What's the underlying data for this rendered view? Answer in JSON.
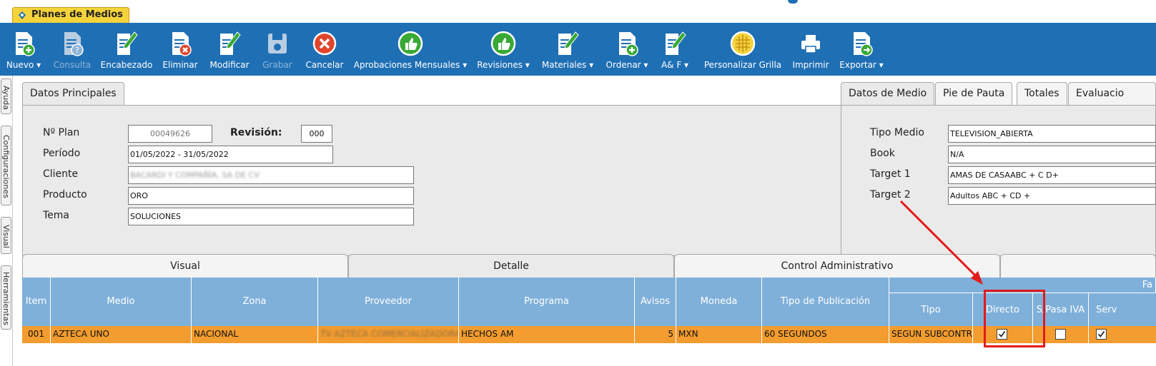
{
  "window": {
    "tab_title": "Planes de Medios"
  },
  "toolbar": {
    "items": [
      {
        "label": "Nuevo ▾",
        "icon": "document-add-icon",
        "enabled": true
      },
      {
        "label": "Consulta",
        "icon": "document-query-icon",
        "enabled": false
      },
      {
        "label": "Encabezado",
        "icon": "document-edit-icon",
        "enabled": true
      },
      {
        "label": "Eliminar",
        "icon": "document-delete-icon",
        "enabled": true
      },
      {
        "label": "Modificar",
        "icon": "document-edit-icon",
        "enabled": true
      },
      {
        "label": "Grabar",
        "icon": "save-icon",
        "enabled": false
      },
      {
        "label": "Cancelar",
        "icon": "cancel-icon",
        "enabled": true
      },
      {
        "label": "Aprobaciones Mensuales ▾",
        "icon": "thumbs-up-icon",
        "enabled": true
      },
      {
        "label": "Revisiones ▾",
        "icon": "thumbs-up-icon",
        "enabled": true
      },
      {
        "label": "Materiales ▾",
        "icon": "document-edit-icon",
        "enabled": true
      },
      {
        "label": "Ordenar ▾",
        "icon": "document-add-icon",
        "enabled": true
      },
      {
        "label": "A& F ▾",
        "icon": "document-edit-icon",
        "enabled": true
      },
      {
        "label": "Personalizar Grilla",
        "icon": "grid-icon",
        "enabled": true
      },
      {
        "label": "Imprimir",
        "icon": "printer-icon",
        "enabled": true
      },
      {
        "label": "Exportar ▾",
        "icon": "export-icon",
        "enabled": true
      }
    ]
  },
  "sidebar": {
    "tabs": [
      "Ayuda",
      "Configuraciones",
      "Visual",
      "Herramientas"
    ]
  },
  "datos_principales": {
    "tab_label": "Datos Principales",
    "plan_label": "Nº Plan",
    "plan_value": "00049626",
    "revision_label": "Revisión:",
    "revision_value": "000",
    "periodo_label": "Período",
    "periodo_value": "01/05/2022 - 31/05/2022",
    "cliente_label": "Cliente",
    "cliente_value": "BACARDI Y COMPAÑÍA, SA DE CV",
    "producto_label": "Producto",
    "producto_value": "ORO",
    "tema_label": "Tema",
    "tema_value": "SOLUCIONES"
  },
  "datos_medio": {
    "tabs": [
      "Datos de Medio",
      "Pie de Pauta",
      "Totales",
      "Evaluacio"
    ],
    "tipo_medio_label": "Tipo Medio",
    "tipo_medio_value": "TELEVISION_ABIERTA",
    "book_label": "Book",
    "book_value": "N/A",
    "target1_label": "Target 1",
    "target1_value": "AMAS DE CASAABC + C D+",
    "target2_label": "Target 2",
    "target2_value": "Adultos ABC + CD +"
  },
  "section_tabs": [
    "Visual",
    "Detalle",
    "Control Administrativo"
  ],
  "grid": {
    "group_header": "Fa",
    "columns": [
      "Item",
      "Medio",
      "Zona",
      "Proveedor",
      "Programa",
      "Avisos",
      "Moneda",
      "Tipo de Publicación",
      "Tipo",
      "Directo",
      "S/Pasa IVA",
      "Serv"
    ],
    "row": {
      "item": "001",
      "medio": "AZTECA UNO",
      "zona": "NACIONAL",
      "proveedor": "TV AZTECA COMERCIALIZADORA",
      "programa": "HECHOS AM",
      "avisos": "5",
      "moneda": "MXN",
      "tipo_publicacion": "60 SEGUNDOS",
      "tipo": "SEGUN SUBCONTRA",
      "directo": true,
      "spasa_iva": false,
      "serv": true
    }
  },
  "colors": {
    "toolbar_bg": "#1f6fb4",
    "grid_header_bg": "#7fb0d9",
    "selected_row_bg": "#f39c2f",
    "annotation_red": "#e21b1b"
  }
}
